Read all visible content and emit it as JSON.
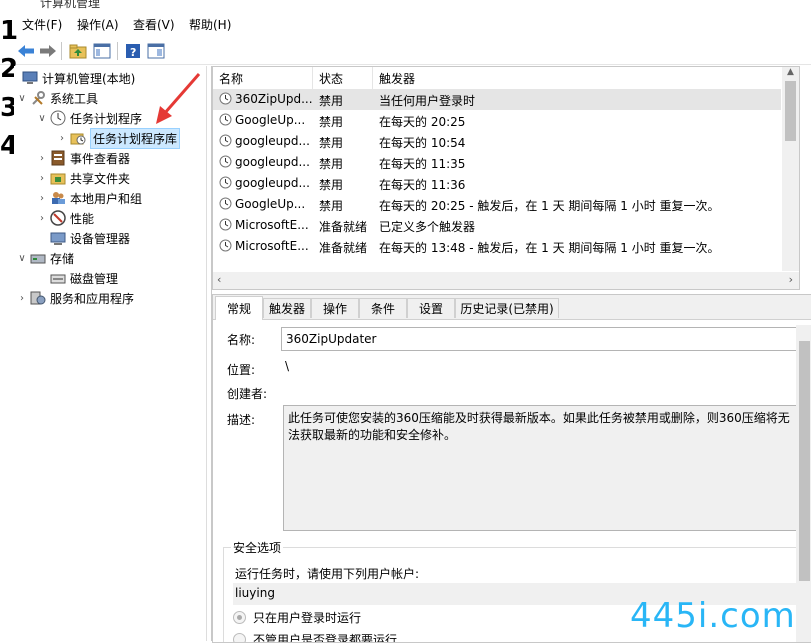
{
  "window": {
    "title": "计算机管理"
  },
  "menu": {
    "file": "文件(F)",
    "action": "操作(A)",
    "view": "查看(V)",
    "help": "帮助(H)"
  },
  "tree": {
    "root": "计算机管理(本地)",
    "system_tools": "系统工具",
    "task_scheduler": "任务计划程序",
    "task_library": "任务计划程序库",
    "event_viewer": "事件查看器",
    "shared_folders": "共享文件夹",
    "local_users": "本地用户和组",
    "performance": "性能",
    "device_manager": "设备管理器",
    "storage": "存储",
    "disk_management": "磁盘管理",
    "services": "服务和应用程序"
  },
  "overlay_numbers": [
    "1",
    "2",
    "3",
    "4"
  ],
  "tasks": {
    "columns": {
      "name": "名称",
      "status": "状态",
      "trigger": "触发器"
    },
    "rows": [
      {
        "name": "360ZipUpd...",
        "status": "禁用",
        "trigger": "当任何用户登录时"
      },
      {
        "name": "GoogleUp...",
        "status": "禁用",
        "trigger": "在每天的 20:25"
      },
      {
        "name": "googleupd...",
        "status": "禁用",
        "trigger": "在每天的 10:54"
      },
      {
        "name": "googleupd...",
        "status": "禁用",
        "trigger": "在每天的 11:35"
      },
      {
        "name": "googleupd...",
        "status": "禁用",
        "trigger": "在每天的 11:36"
      },
      {
        "name": "GoogleUp...",
        "status": "禁用",
        "trigger": "在每天的 20:25 - 触发后，在 1 天 期间每隔 1 小时 重复一次。"
      },
      {
        "name": "MicrosoftE...",
        "status": "准备就绪",
        "trigger": "已定义多个触发器"
      },
      {
        "name": "MicrosoftE...",
        "status": "准备就绪",
        "trigger": "在每天的 13:48 - 触发后，在 1 天 期间每隔 1 小时 重复一次。"
      }
    ]
  },
  "detail": {
    "tabs": [
      "常规",
      "触发器",
      "操作",
      "条件",
      "设置",
      "历史记录(已禁用)"
    ],
    "name_label": "名称:",
    "name_value": "360ZipUpdater",
    "location_label": "位置:",
    "location_value": "\\",
    "author_label": "创建者:",
    "desc_label": "描述:",
    "desc_value": "此任务可使您安装的360压缩能及时获得最新版本。如果此任务被禁用或删除，则360压缩将无法获取最新的功能和安全修补。",
    "security_group": "安全选项",
    "run_as_label": "运行任务时，请使用下列用户帐户:",
    "run_as_value": "liuying",
    "option1": "只在用户登录时运行",
    "option2": "不管用户是否登录都要运行"
  },
  "watermark": "445i.com",
  "colors": {
    "selection": "#cce8ff",
    "watermark": "#29b6f6",
    "arrow": "#e53935"
  }
}
